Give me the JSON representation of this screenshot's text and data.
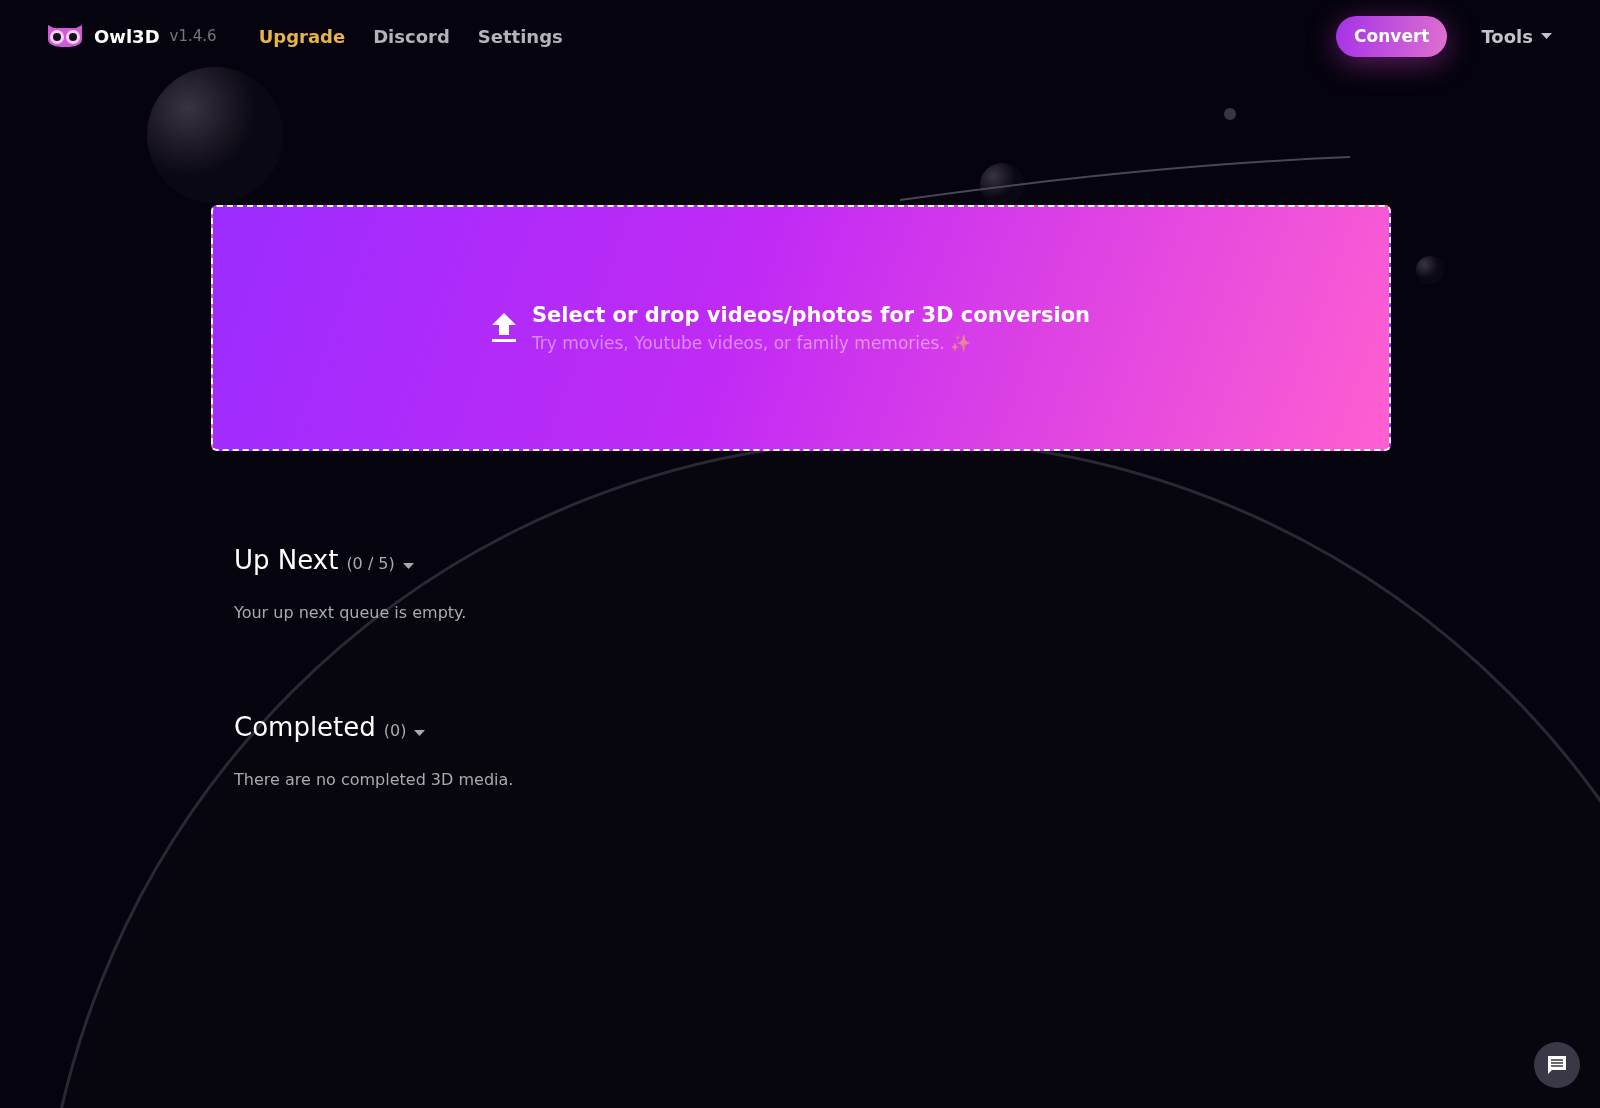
{
  "app": {
    "name": "Owl3D",
    "version": "v1.4.6"
  },
  "nav": [
    {
      "label": "Upgrade",
      "kind": "highlight"
    },
    {
      "label": "Discord",
      "kind": "plain"
    },
    {
      "label": "Settings",
      "kind": "plain"
    }
  ],
  "convert_button": "Convert",
  "tools_menu": "Tools",
  "dropzone": {
    "title": "Select or drop videos/photos for 3D conversion",
    "subtitle": "Try movies, Youtube videos, or family memories. ✨"
  },
  "sections": [
    {
      "title": "Up Next",
      "count": "(0 / 5)",
      "message": "Your up next queue is empty."
    },
    {
      "title": "Completed",
      "count": "(0)",
      "message": "There are no completed 3D media."
    }
  ]
}
